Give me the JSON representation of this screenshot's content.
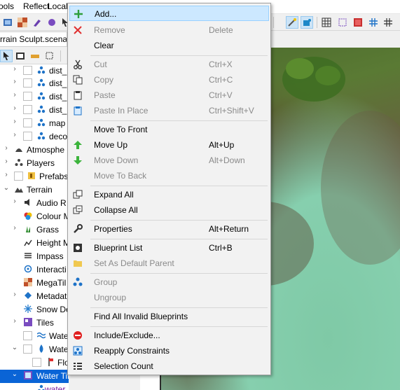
{
  "menubar": {
    "items": [
      {
        "label": "ools"
      },
      {
        "label": "Reflect"
      },
      {
        "label": "Local"
      }
    ]
  },
  "scene_tab": {
    "label": "rrain Sculpt.scena"
  },
  "tree": {
    "rows": [
      {
        "label": "dist_",
        "icon": "blueprint-icon"
      },
      {
        "label": "dist_",
        "icon": "blueprint-icon"
      },
      {
        "label": "dist_",
        "icon": "blueprint-icon"
      },
      {
        "label": "dist_",
        "icon": "blueprint-icon"
      },
      {
        "label": "map",
        "icon": "blueprint-icon"
      },
      {
        "label": "deco",
        "icon": "blueprint-icon"
      },
      {
        "label": "Atmosphe",
        "icon": "atmosphere-icon"
      },
      {
        "label": "Players",
        "icon": "players-icon"
      },
      {
        "label": "Prefabs",
        "icon": "prefab-icon"
      },
      {
        "label": "Terrain",
        "icon": "terrain-icon"
      },
      {
        "label": "Audio R",
        "icon": "audio-icon"
      },
      {
        "label": "Colour M",
        "icon": "colour-icon"
      },
      {
        "label": "Grass",
        "icon": "grass-icon"
      },
      {
        "label": "Height M",
        "icon": "height-icon"
      },
      {
        "label": "Impass",
        "icon": "impass-icon"
      },
      {
        "label": "Interacti",
        "icon": "interaction-icon"
      },
      {
        "label": "MegaTil",
        "icon": "megatile-icon"
      },
      {
        "label": "Metadat",
        "icon": "metadata-icon"
      },
      {
        "label": "Snow De",
        "icon": "snow-icon"
      },
      {
        "label": "Tiles",
        "icon": "tiles-icon"
      },
      {
        "label": "Wate",
        "icon": "water-icon"
      },
      {
        "label": "Wate",
        "icon": "water-drop-icon"
      },
      {
        "label": "Flo",
        "icon": "flow-icon"
      },
      {
        "label": "Water Tiles",
        "icon": "water-tiles-icon"
      },
      {
        "label": "water_calm",
        "icon": "blueprint-icon"
      }
    ]
  },
  "context_menu": {
    "items": [
      {
        "label": "Add...",
        "shortcut": "",
        "icon": "plus-icon",
        "disabled": false,
        "highlighted": true
      },
      {
        "label": "Remove",
        "shortcut": "Delete",
        "icon": "remove-x-icon",
        "disabled": true
      },
      {
        "label": "Clear",
        "shortcut": "",
        "icon": "",
        "disabled": false
      },
      {
        "label": "Cut",
        "shortcut": "Ctrl+X",
        "icon": "scissors-icon",
        "disabled": true
      },
      {
        "label": "Copy",
        "shortcut": "Ctrl+C",
        "icon": "copy-icon",
        "disabled": true
      },
      {
        "label": "Paste",
        "shortcut": "Ctrl+V",
        "icon": "paste-icon",
        "disabled": true
      },
      {
        "label": "Paste In Place",
        "shortcut": "Ctrl+Shift+V",
        "icon": "paste-in-place-icon",
        "disabled": true
      },
      {
        "label": "Move To Front",
        "shortcut": "",
        "icon": "",
        "disabled": false
      },
      {
        "label": "Move Up",
        "shortcut": "Alt+Up",
        "icon": "arrow-up-icon",
        "disabled": false
      },
      {
        "label": "Move Down",
        "shortcut": "Alt+Down",
        "icon": "arrow-down-icon",
        "disabled": true
      },
      {
        "label": "Move To Back",
        "shortcut": "",
        "icon": "",
        "disabled": true
      },
      {
        "label": "Expand All",
        "shortcut": "",
        "icon": "expand-all-icon",
        "disabled": false
      },
      {
        "label": "Collapse All",
        "shortcut": "",
        "icon": "collapse-all-icon",
        "disabled": false
      },
      {
        "label": "Properties",
        "shortcut": "Alt+Return",
        "icon": "wrench-icon",
        "disabled": false
      },
      {
        "label": "Blueprint List",
        "shortcut": "Ctrl+B",
        "icon": "blueprint-list-icon",
        "disabled": false
      },
      {
        "label": "Set As Default Parent",
        "shortcut": "",
        "icon": "folder-icon",
        "disabled": true
      },
      {
        "label": "Group",
        "shortcut": "",
        "icon": "group-icon",
        "disabled": true
      },
      {
        "label": "Ungroup",
        "shortcut": "",
        "icon": "",
        "disabled": true
      },
      {
        "label": "Find All Invalid Blueprints",
        "shortcut": "",
        "icon": "",
        "disabled": false
      },
      {
        "label": "Include/Exclude...",
        "shortcut": "",
        "icon": "include-exclude-icon",
        "disabled": false
      },
      {
        "label": "Reapply Constraints",
        "shortcut": "",
        "icon": "constraints-icon",
        "disabled": false
      },
      {
        "label": "Selection Count",
        "shortcut": "",
        "icon": "selection-count-icon",
        "disabled": false
      }
    ]
  },
  "colors": {
    "selection": "#0a64d6",
    "menu_highlight": "#cce8ff",
    "disabled_text": "#8a8a8a",
    "add_green": "#2e9e3a",
    "remove_red": "#e03030",
    "blueprint_blue": "#1e73c8",
    "water": "#86cfae"
  }
}
